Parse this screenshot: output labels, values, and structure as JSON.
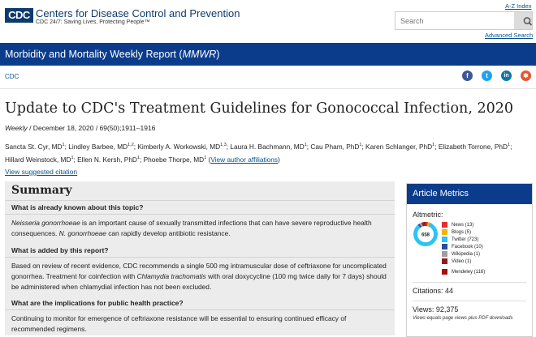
{
  "header": {
    "logo_text": "CDC",
    "org_name": "Centers for Disease Control and Prevention",
    "org_tagline": "CDC 24/7: Saving Lives, Protecting People™",
    "az_index": "A-Z Index",
    "search_placeholder": "Search",
    "advanced_search": "Advanced Search"
  },
  "bluebar": {
    "title_prefix": "Morbidity and Mortality Weekly Report (",
    "title_em": "MMWR",
    "title_suffix": ")"
  },
  "breadcrumb": "CDC",
  "social": [
    {
      "name": "facebook-icon",
      "glyph": "f",
      "color": "#3b5998"
    },
    {
      "name": "twitter-icon",
      "glyph": "t",
      "color": "#1da1f2"
    },
    {
      "name": "linkedin-icon",
      "glyph": "in",
      "color": "#0e76a8"
    },
    {
      "name": "syndicate-icon",
      "glyph": "✱",
      "color": "#e8552c"
    }
  ],
  "article": {
    "title": "Update to CDC's Treatment Guidelines for Gonococcal Infection, 2020",
    "meta_weekly": "Weekly",
    "meta_rest": " / December 18, 2020 / 69(50);1911–1916",
    "authors": [
      {
        "name": "Sancta St. Cyr, MD",
        "sup": "1"
      },
      {
        "name": "Lindley Barbee, MD",
        "sup": "1,2"
      },
      {
        "name": "Kimberly A. Workowski, MD",
        "sup": "1,3"
      },
      {
        "name": "Laura H. Bachmann, MD",
        "sup": "1"
      },
      {
        "name": "Cau Pham, PhD",
        "sup": "1"
      },
      {
        "name": "Karen Schlanger, PhD",
        "sup": "1"
      },
      {
        "name": "Elizabeth Torrone, PhD",
        "sup": "1"
      },
      {
        "name": "Hillard Weinstock, MD",
        "sup": "1"
      },
      {
        "name": "Ellen N. Kersh, PhD",
        "sup": "1"
      },
      {
        "name": "Phoebe Thorpe, MD",
        "sup": "1"
      }
    ],
    "affiliations_link": "View author affiliations",
    "citation_link": "View suggested citation"
  },
  "summary": {
    "heading": "Summary",
    "q1": "What is already known about this topic?",
    "a1_em": "Neisseria gonorrhoeae",
    "a1_text": " is an important cause of sexually transmitted infections that can have severe reproductive health consequences. ",
    "a1_em2": "N. gonorrhoeae",
    "a1_text2": " can rapidly develop antibiotic resistance.",
    "q2": "What is added by this report?",
    "a2_text": "Based on review of recent evidence, CDC recommends a single 500 mg intramuscular dose of ceftriaxone for uncomplicated gonorrhea. Treatment for coinfection with ",
    "a2_em": "Chlamydia trachomatis",
    "a2_text2": " with oral doxycycline (100 mg twice daily for 7 days) should be administered when chlamydial infection has not been excluded.",
    "q3": "What are the implications for public health practice?",
    "a3_text": "Continuing to monitor for emergence of ceftriaxone resistance will be essential to ensuring continued efficacy of recommended regimens."
  },
  "metrics": {
    "heading": "Article Metrics",
    "altmetric_label": "Altmetric:",
    "altmetric_score": "658",
    "legend": [
      {
        "label": "News (13)",
        "color": "#e52d2d",
        "share": 13
      },
      {
        "label": "Blogs (5)",
        "color": "#f4b400",
        "share": 5
      },
      {
        "label": "Twitter (723)",
        "color": "#2bc4f4",
        "share": 723
      },
      {
        "label": "Facebook (10)",
        "color": "#2d4c9c",
        "share": 10
      },
      {
        "label": "Wikipedia (1)",
        "color": "#9e9e9e",
        "share": 1
      },
      {
        "label": "Video (1)",
        "color": "#8e1d1d",
        "share": 1
      },
      {
        "label": "Mendeley (116)",
        "color": "#a50e0e",
        "share": 116
      }
    ],
    "citations": "Citations: 44",
    "views": "Views: 92,375",
    "views_note": "Views equals page views plus PDF downloads"
  }
}
